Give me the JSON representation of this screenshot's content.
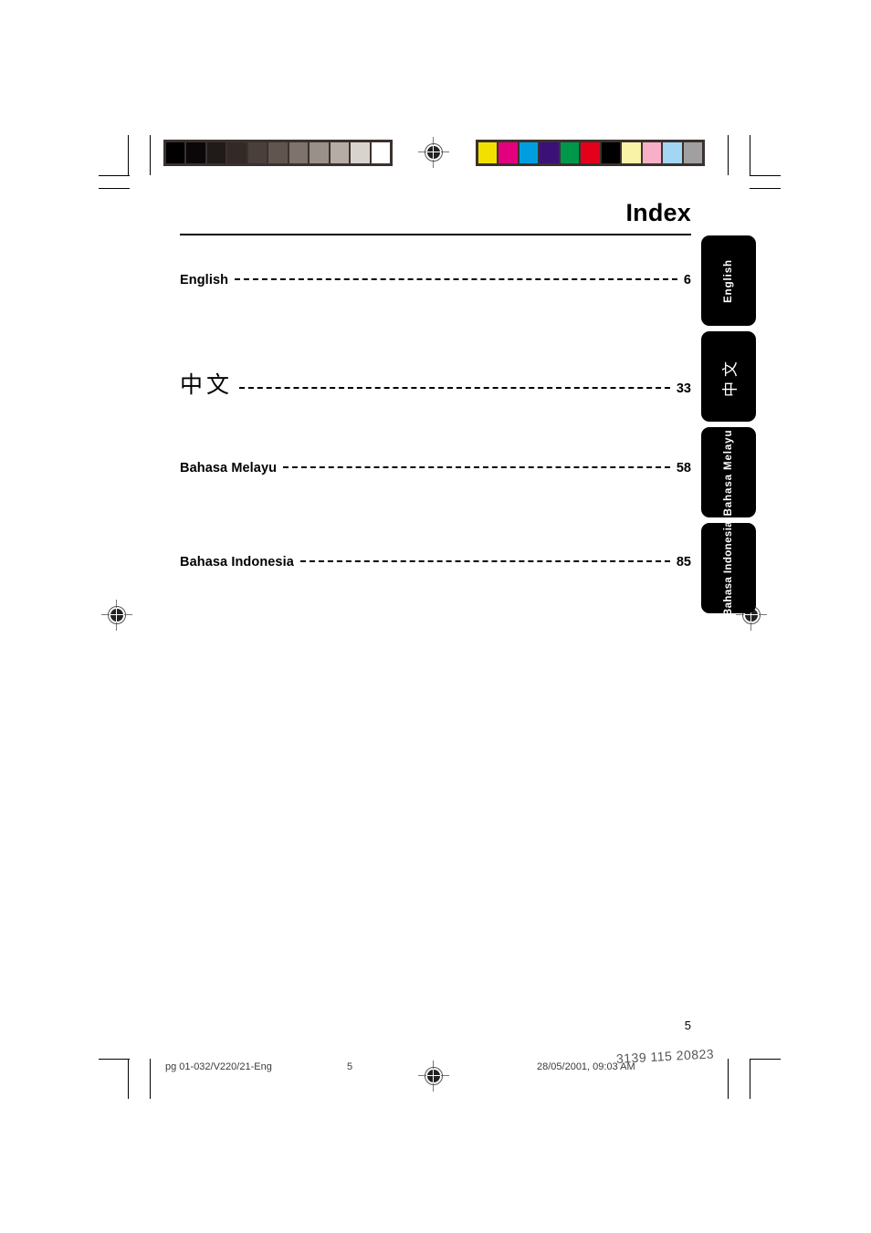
{
  "document": {
    "title": "Index",
    "folio": "5"
  },
  "index": {
    "entries": [
      {
        "label": "English",
        "page": "6",
        "script": "latin"
      },
      {
        "label": "中文",
        "page": "33",
        "script": "cjk"
      },
      {
        "label": "Bahasa Melayu",
        "page": "58",
        "script": "latin"
      },
      {
        "label": "Bahasa Indonesia",
        "page": "85",
        "script": "latin"
      }
    ]
  },
  "side_tabs": [
    {
      "label": "English",
      "script": "latin"
    },
    {
      "label": "中文",
      "script": "cjk"
    },
    {
      "label": "Bahasa Melayu",
      "script": "latin"
    },
    {
      "label": "Bahasa Indonesia",
      "script": "latin-overflow"
    }
  ],
  "print_marks": {
    "grayscale_strip": [
      "#000000",
      "#0b0708",
      "#201a18",
      "#332a27",
      "#4a3f3a",
      "#60554f",
      "#7e736d",
      "#9a908a",
      "#b5aca6",
      "#d9d3cd",
      "#ffffff"
    ],
    "color_strip": [
      "#f2e000",
      "#e3007f",
      "#009ee0",
      "#3b1178",
      "#00974b",
      "#e2001a",
      "#000000",
      "#f9f3a8",
      "#f8b0c8",
      "#a3d6f2",
      "#a0a0a0"
    ]
  },
  "footer": {
    "filename": "pg 01-032/V220/21-Eng",
    "sheet": "5",
    "timestamp": "28/05/2001, 09:03 AM",
    "part_number": "3139 115 20823"
  }
}
